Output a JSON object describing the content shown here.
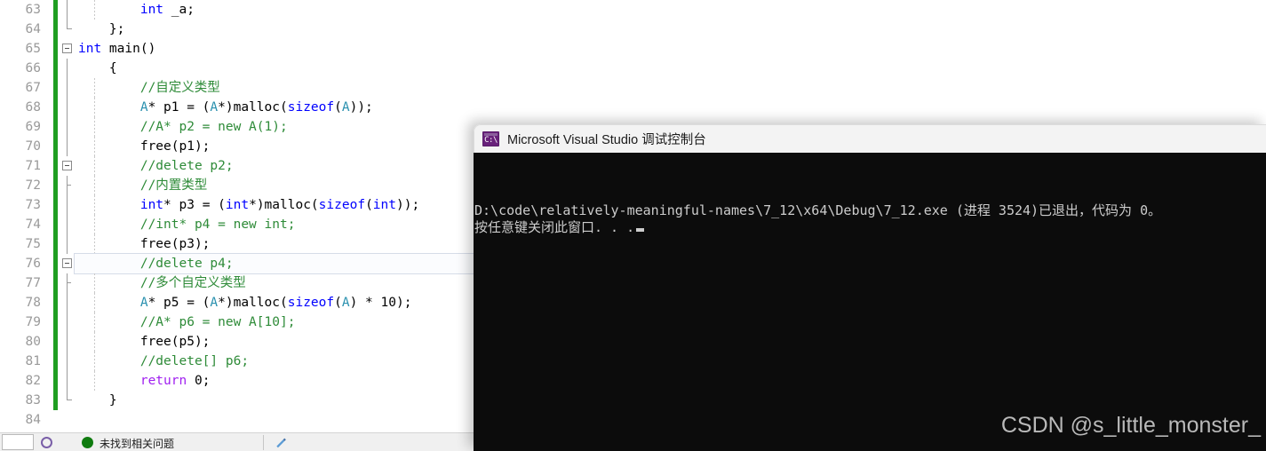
{
  "editor": {
    "name": "visual-studio-code-editor",
    "first_line_number": 63,
    "current_line": 76,
    "colors": {
      "keyword": "#0000ff",
      "control_keyword": "#a020f0",
      "user_type": "#2b91af",
      "comment": "#2e8b38",
      "line_number": "#9a9a9a",
      "change_bar": "#1f9e21",
      "background": "#ffffff"
    },
    "lines": [
      {
        "n": "63",
        "indent": 2,
        "fold": "line",
        "guide": true,
        "tokens": [
          {
            "t": "        ",
            "c": "plain"
          },
          {
            "t": "int",
            "c": "kw"
          },
          {
            "t": " _a;",
            "c": "plain"
          }
        ]
      },
      {
        "n": "64",
        "indent": 1,
        "fold": "endcap",
        "guide": false,
        "tokens": [
          {
            "t": "    };",
            "c": "plain"
          }
        ]
      },
      {
        "n": "65",
        "indent": 0,
        "fold": "box",
        "guide": false,
        "tokens": [
          {
            "t": "int",
            "c": "kw"
          },
          {
            "t": " main()",
            "c": "plain"
          }
        ]
      },
      {
        "n": "66",
        "indent": 1,
        "fold": "line",
        "guide": false,
        "tokens": [
          {
            "t": "    {",
            "c": "plain"
          }
        ]
      },
      {
        "n": "67",
        "indent": 1,
        "fold": "line",
        "guide": true,
        "tokens": [
          {
            "t": "        //自定义类型",
            "c": "cmt"
          }
        ]
      },
      {
        "n": "68",
        "indent": 1,
        "fold": "line",
        "guide": true,
        "tokens": [
          {
            "t": "        ",
            "c": "plain"
          },
          {
            "t": "A",
            "c": "type"
          },
          {
            "t": "* p1 = (",
            "c": "plain"
          },
          {
            "t": "A",
            "c": "type"
          },
          {
            "t": "*)malloc(",
            "c": "plain"
          },
          {
            "t": "sizeof",
            "c": "kw"
          },
          {
            "t": "(",
            "c": "plain"
          },
          {
            "t": "A",
            "c": "type"
          },
          {
            "t": "));",
            "c": "plain"
          }
        ]
      },
      {
        "n": "69",
        "indent": 1,
        "fold": "line",
        "guide": true,
        "tokens": [
          {
            "t": "        //A* p2 = new A(1);",
            "c": "cmt"
          }
        ]
      },
      {
        "n": "70",
        "indent": 1,
        "fold": "line",
        "guide": true,
        "tokens": [
          {
            "t": "        free(p1);",
            "c": "plain"
          }
        ]
      },
      {
        "n": "71",
        "indent": 1,
        "fold": "box",
        "guide": true,
        "tokens": [
          {
            "t": "        //delete p2;",
            "c": "cmt"
          }
        ]
      },
      {
        "n": "72",
        "indent": 1,
        "fold": "tick",
        "guide": true,
        "tokens": [
          {
            "t": "        //内置类型",
            "c": "cmt"
          }
        ]
      },
      {
        "n": "73",
        "indent": 1,
        "fold": "line",
        "guide": true,
        "tokens": [
          {
            "t": "        ",
            "c": "plain"
          },
          {
            "t": "int",
            "c": "kw"
          },
          {
            "t": "* p3 = (",
            "c": "plain"
          },
          {
            "t": "int",
            "c": "kw"
          },
          {
            "t": "*)malloc(",
            "c": "plain"
          },
          {
            "t": "sizeof",
            "c": "kw"
          },
          {
            "t": "(",
            "c": "plain"
          },
          {
            "t": "int",
            "c": "kw"
          },
          {
            "t": "));",
            "c": "plain"
          }
        ]
      },
      {
        "n": "74",
        "indent": 1,
        "fold": "line",
        "guide": true,
        "tokens": [
          {
            "t": "        //int* p4 = new int;",
            "c": "cmt"
          }
        ]
      },
      {
        "n": "75",
        "indent": 1,
        "fold": "line",
        "guide": true,
        "tokens": [
          {
            "t": "        free(p3);",
            "c": "plain"
          }
        ]
      },
      {
        "n": "76",
        "indent": 1,
        "fold": "box",
        "guide": true,
        "tokens": [
          {
            "t": "        //delete p4;",
            "c": "cmt"
          }
        ]
      },
      {
        "n": "77",
        "indent": 1,
        "fold": "tick",
        "guide": true,
        "tokens": [
          {
            "t": "        //多个自定义类型",
            "c": "cmt"
          }
        ]
      },
      {
        "n": "78",
        "indent": 1,
        "fold": "line",
        "guide": true,
        "tokens": [
          {
            "t": "        ",
            "c": "plain"
          },
          {
            "t": "A",
            "c": "type"
          },
          {
            "t": "* p5 = (",
            "c": "plain"
          },
          {
            "t": "A",
            "c": "type"
          },
          {
            "t": "*)malloc(",
            "c": "plain"
          },
          {
            "t": "sizeof",
            "c": "kw"
          },
          {
            "t": "(",
            "c": "plain"
          },
          {
            "t": "A",
            "c": "type"
          },
          {
            "t": ") * 10);",
            "c": "plain"
          }
        ]
      },
      {
        "n": "79",
        "indent": 1,
        "fold": "line",
        "guide": true,
        "tokens": [
          {
            "t": "        //A* p6 = new A[10];",
            "c": "cmt"
          }
        ]
      },
      {
        "n": "80",
        "indent": 1,
        "fold": "line",
        "guide": true,
        "tokens": [
          {
            "t": "        free(p5);",
            "c": "plain"
          }
        ]
      },
      {
        "n": "81",
        "indent": 1,
        "fold": "line",
        "guide": true,
        "tokens": [
          {
            "t": "        //delete[] p6;",
            "c": "cmt"
          }
        ]
      },
      {
        "n": "82",
        "indent": 1,
        "fold": "line",
        "guide": true,
        "tokens": [
          {
            "t": "        ",
            "c": "plain"
          },
          {
            "t": "return",
            "c": "ctrl"
          },
          {
            "t": " ",
            "c": "plain"
          },
          {
            "t": "0",
            "c": "num"
          },
          {
            "t": ";",
            "c": "plain"
          }
        ]
      },
      {
        "n": "83",
        "indent": 1,
        "fold": "endcap",
        "guide": false,
        "tokens": [
          {
            "t": "    }",
            "c": "plain"
          }
        ]
      },
      {
        "n": "84",
        "indent": 0,
        "fold": "none",
        "guide": false,
        "tokens": [
          {
            "t": "",
            "c": "plain"
          }
        ]
      }
    ]
  },
  "statusbar": {
    "name": "visual-studio-status-bar",
    "text": "未找到相关问题",
    "clipped": true
  },
  "console": {
    "name": "debug-console-window",
    "icon": "console-app-icon",
    "icon_glyph": "C:\\",
    "title": "Microsoft Visual Studio 调试控制台",
    "background": "#0c0c0c",
    "foreground": "#cccccc",
    "lines": [
      "D:\\code\\relatively-meaningful-names\\7_12\\x64\\Debug\\7_12.exe (进程 3524)已退出，代码为 0。",
      "按任意键关闭此窗口. . ."
    ],
    "caret": "block-cursor"
  },
  "watermark": {
    "name": "csdn-watermark",
    "text": "CSDN @s_little_monster_"
  }
}
